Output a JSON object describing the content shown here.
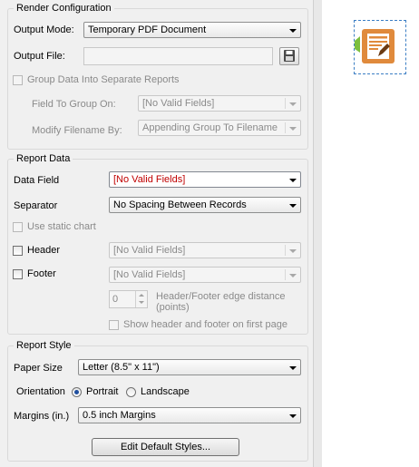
{
  "render": {
    "title": "Render Configuration",
    "output_mode_label": "Output Mode:",
    "output_mode_value": "Temporary PDF Document",
    "output_file_label": "Output File:",
    "output_file_value": "",
    "group_data_label": "Group Data Into Separate Reports",
    "field_to_group_label": "Field To Group On:",
    "field_to_group_value": "[No Valid Fields]",
    "modify_filename_label": "Modify Filename By:",
    "modify_filename_value": "Appending Group To Filename"
  },
  "report_data": {
    "title": "Report Data",
    "data_field_label": "Data Field",
    "data_field_value": "[No Valid Fields]",
    "separator_label": "Separator",
    "separator_value": "No Spacing Between Records",
    "static_chart_label": "Use static chart",
    "header_label": "Header",
    "header_value": "[No Valid Fields]",
    "footer_label": "Footer",
    "footer_value": "[No Valid Fields]",
    "edge_distance_value": "0",
    "edge_distance_label_line1": "Header/Footer edge distance",
    "edge_distance_label_line2": "(points)",
    "show_first_page_label": "Show header and footer on first page"
  },
  "report_style": {
    "title": "Report Style",
    "paper_size_label": "Paper Size",
    "paper_size_value": "Letter (8.5\" x 11\")",
    "orientation_label": "Orientation",
    "portrait_label": "Portrait",
    "landscape_label": "Landscape",
    "orientation_selected": "Portrait",
    "margins_label": "Margins (in.)",
    "margins_value": "0.5 inch Margins",
    "edit_styles_label": "Edit Default Styles..."
  },
  "colors": {
    "accent": "#3b7ec4",
    "tool_icon": "#e08a3c",
    "tool_connector": "#7cbf3f",
    "invalid_text": "#c00000"
  },
  "icons": {
    "save": "floppy-disk-icon",
    "tool": "report-render-tool-icon"
  }
}
